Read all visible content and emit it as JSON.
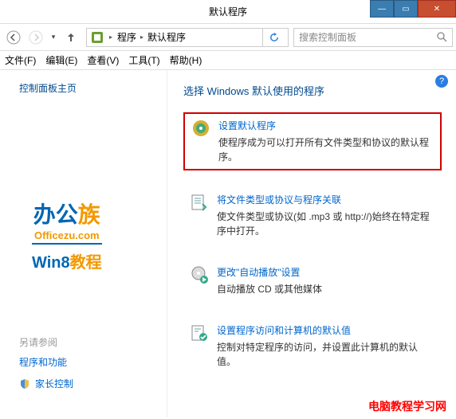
{
  "window": {
    "title": "默认程序"
  },
  "breadcrumb": {
    "item1": "程序",
    "item2": "默认程序"
  },
  "search": {
    "placeholder": "搜索控制面板"
  },
  "menu": {
    "file": "文件(F)",
    "edit": "编辑(E)",
    "view": "查看(V)",
    "tools": "工具(T)",
    "help": "帮助(H)"
  },
  "sidebar": {
    "title": "控制面板主页",
    "watermark_main1": "办公",
    "watermark_main2": "族",
    "watermark_sub": "Officezu.com",
    "watermark_line2a": "Win8",
    "watermark_line2b": "教程",
    "seealso_label": "另请参阅",
    "link1": "程序和功能",
    "link2": "家长控制"
  },
  "main": {
    "heading": "选择 Windows 默认使用的程序",
    "options": [
      {
        "title": "设置默认程序",
        "desc": "使程序成为可以打开所有文件类型和协议的默认程序。"
      },
      {
        "title": "将文件类型或协议与程序关联",
        "desc": "使文件类型或协议(如 .mp3 或 http://)始终在特定程序中打开。"
      },
      {
        "title": "更改\"自动播放\"设置",
        "desc": "自动播放 CD 或其他媒体"
      },
      {
        "title": "设置程序访问和计算机的默认值",
        "desc": "控制对特定程序的访问，并设置此计算机的默认值。"
      }
    ]
  },
  "footer_watermark": "电脑教程学习网"
}
